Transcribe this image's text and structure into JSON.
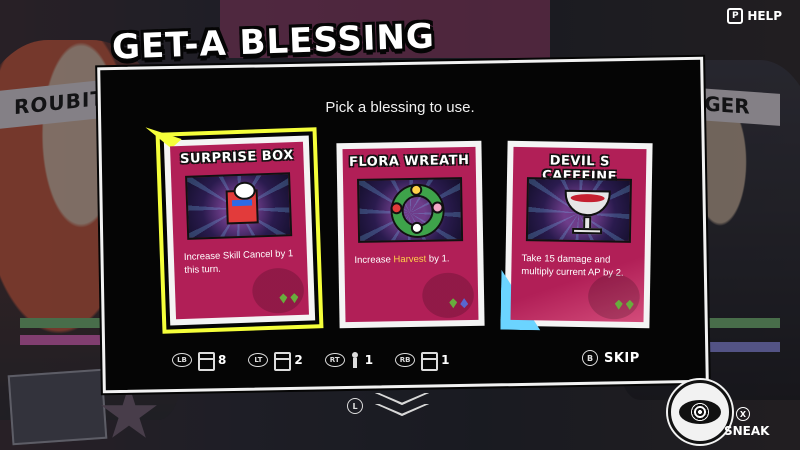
{
  "header": {
    "help_label": "HELP",
    "help_button_glyph": "P"
  },
  "background": {
    "left_name": "ROUBIT",
    "right_name": "ANGER"
  },
  "dialog": {
    "title": "Get-A Blessing",
    "subtitle": "Pick a blessing to use."
  },
  "cards": [
    {
      "name": "SURPRISE BOX",
      "description": "Increase Skill Cancel by 1 this turn.",
      "icon": "gift-box-icon",
      "selected": true
    },
    {
      "name": "FLORA WREATH",
      "description_prefix": "Increase ",
      "description_highlight": "Harvest",
      "description_suffix": " by 1.",
      "icon": "wreath-icon",
      "selected": false
    },
    {
      "name": "DEVIL S CAFFEINE",
      "description": "Take 15 damage and multiply current AP by 2.",
      "icon": "goblet-icon",
      "selected": false
    }
  ],
  "counters": [
    {
      "button": "LB",
      "icon": "card-stack-icon",
      "value": "8"
    },
    {
      "button": "LT",
      "icon": "card-stack-icon",
      "value": "2"
    },
    {
      "button": "RT",
      "icon": "person-icon",
      "value": "1"
    },
    {
      "button": "RB",
      "icon": "card-stack-icon",
      "value": "1"
    }
  ],
  "skip": {
    "button": "B",
    "label": "SKIP"
  },
  "scroll_hint": {
    "button": "L"
  },
  "sneak": {
    "button": "X",
    "label": "SNEAK"
  },
  "colors": {
    "card_red": "#b11f57",
    "selection_yellow": "#f5ff3a",
    "highlight": "#ffd24a"
  }
}
